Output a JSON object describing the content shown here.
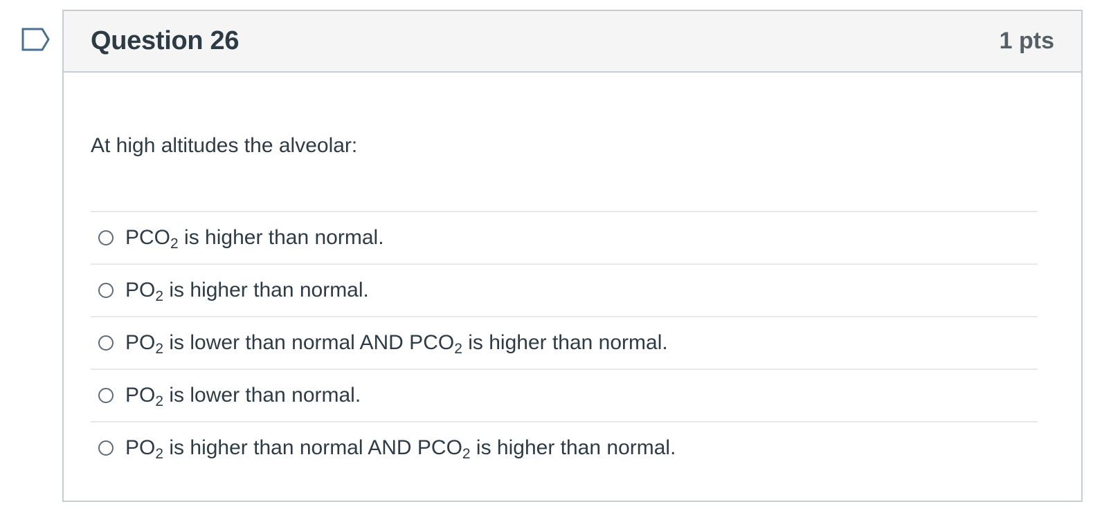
{
  "question": {
    "title": "Question 26",
    "points": "1 pts",
    "text": "At high altitudes the alveolar:",
    "flag_icon": "bookmark-flag-icon"
  },
  "answers": [
    {
      "label_parts": [
        {
          "text": "PCO"
        },
        {
          "sub": "2"
        },
        {
          "text": " is higher than normal."
        }
      ]
    },
    {
      "label_parts": [
        {
          "text": "PO"
        },
        {
          "sub": "2"
        },
        {
          "text": " is higher than normal."
        }
      ]
    },
    {
      "label_parts": [
        {
          "text": "PO"
        },
        {
          "sub": "2"
        },
        {
          "text": " is lower than normal AND PCO"
        },
        {
          "sub": "2"
        },
        {
          "text": " is higher than normal."
        }
      ]
    },
    {
      "label_parts": [
        {
          "text": "PO"
        },
        {
          "sub": "2"
        },
        {
          "text": " is lower than normal."
        }
      ]
    },
    {
      "label_parts": [
        {
          "text": "PO"
        },
        {
          "sub": "2"
        },
        {
          "text": " is higher than normal AND PCO"
        },
        {
          "sub": "2"
        },
        {
          "text": " is higher than normal."
        }
      ]
    }
  ],
  "colors": {
    "flag_stroke": "#4a6f91",
    "border": "#c7cdd1",
    "header_bg": "#f5f5f5",
    "text": "#2d3b45"
  }
}
